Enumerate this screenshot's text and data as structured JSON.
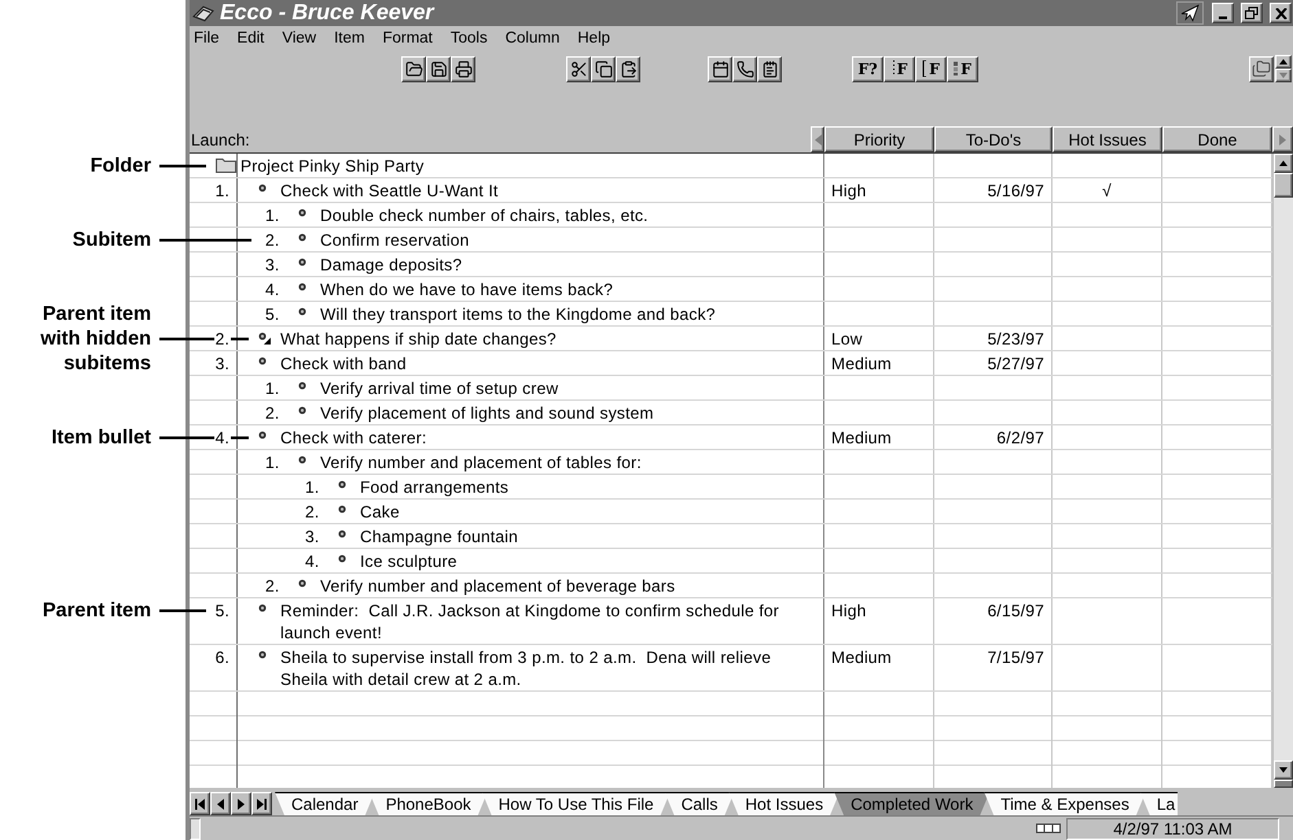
{
  "window": {
    "title": "Ecco - Bruce Keever"
  },
  "menu": [
    "File",
    "Edit",
    "View",
    "Item",
    "Format",
    "Tools",
    "Column",
    "Help"
  ],
  "toolbar": {
    "filter_buttons": [
      {
        "label": "F?",
        "kind": "query"
      },
      {
        "label": "F",
        "kind": "dotted"
      },
      {
        "label": "F",
        "kind": "bracket"
      },
      {
        "label": "F",
        "kind": "stacked"
      }
    ]
  },
  "outline": {
    "header": "Launch:",
    "columns": [
      "Priority",
      "To-Do's",
      "Hot Issues",
      "Done"
    ],
    "folder": {
      "name": "Project Pinky Ship Party",
      "callout": {
        "label": "Folder",
        "kind": "icon"
      }
    },
    "items": [
      {
        "number": "1.",
        "text": "Check with Seattle U-Want It",
        "priority": "High",
        "todo": "5/16/97",
        "hot_issues": "√",
        "hidden_subitems": false,
        "children": [
          {
            "number": "1.",
            "text": "Double check number of chairs, tables, etc.",
            "hidden_subitems": false
          },
          {
            "number": "2.",
            "text": "Confirm reservation",
            "hidden_subitems": false,
            "callout": {
              "label": "Subitem",
              "kind": "number"
            }
          },
          {
            "number": "3.",
            "text": "Damage deposits?",
            "hidden_subitems": false
          },
          {
            "number": "4.",
            "text": "When do we have to have items back?",
            "hidden_subitems": false
          },
          {
            "number": "5.",
            "text": "Will they transport items to the Kingdome and back?",
            "hidden_subitems": false
          }
        ]
      },
      {
        "number": "2.",
        "text": "What happens if ship date changes?",
        "priority": "Low",
        "todo": "5/23/97",
        "hidden_subitems": true,
        "callout": {
          "label": "Parent item with hidden subitems",
          "kind": "bullet"
        }
      },
      {
        "number": "3.",
        "text": "Check with band",
        "priority": "Medium",
        "todo": "5/27/97",
        "hidden_subitems": false,
        "children": [
          {
            "number": "1.",
            "text": "Verify arrival time of setup crew",
            "hidden_subitems": false
          },
          {
            "number": "2.",
            "text": "Verify placement of lights and sound system",
            "hidden_subitems": false
          }
        ]
      },
      {
        "number": "4.",
        "text": "Check with caterer:",
        "priority": "Medium",
        "todo": "6/2/97",
        "hidden_subitems": false,
        "callout": {
          "label": "Item bullet",
          "kind": "bullet"
        },
        "children": [
          {
            "number": "1.",
            "text": "Verify number and placement of tables for:",
            "hidden_subitems": false,
            "children": [
              {
                "number": "1.",
                "text": "Food arrangements",
                "hidden_subitems": false
              },
              {
                "number": "2.",
                "text": "Cake",
                "hidden_subitems": false
              },
              {
                "number": "3.",
                "text": "Champagne fountain",
                "hidden_subitems": false
              },
              {
                "number": "4.",
                "text": "Ice sculpture",
                "hidden_subitems": false
              }
            ]
          },
          {
            "number": "2.",
            "text": "Verify number and placement of beverage bars",
            "hidden_subitems": false
          }
        ]
      },
      {
        "number": "5.",
        "text": "Reminder:  Call J.R. Jackson at Kingdome to confirm schedule for launch event!",
        "priority": "High",
        "todo": "6/15/97",
        "hidden_subitems": false,
        "callout": {
          "label": "Parent item",
          "kind": "number"
        }
      },
      {
        "number": "6.",
        "text": "Sheila to supervise install from 3 p.m. to 2 a.m.  Dena will relieve Sheila with detail crew at 2 a.m.",
        "priority": "Medium",
        "todo": "7/15/97",
        "hidden_subitems": false
      }
    ]
  },
  "tabs": [
    {
      "label": "Calendar",
      "selected": false
    },
    {
      "label": "PhoneBook",
      "selected": false
    },
    {
      "label": "How To Use This File",
      "selected": false
    },
    {
      "label": "Calls",
      "selected": false
    },
    {
      "label": "Hot Issues",
      "selected": false
    },
    {
      "label": "Completed Work",
      "selected": true
    },
    {
      "label": "Time & Expenses",
      "selected": false
    },
    {
      "label": "La",
      "selected": false
    }
  ],
  "status_bar": {
    "datetime": "4/2/97 11:03 AM"
  }
}
